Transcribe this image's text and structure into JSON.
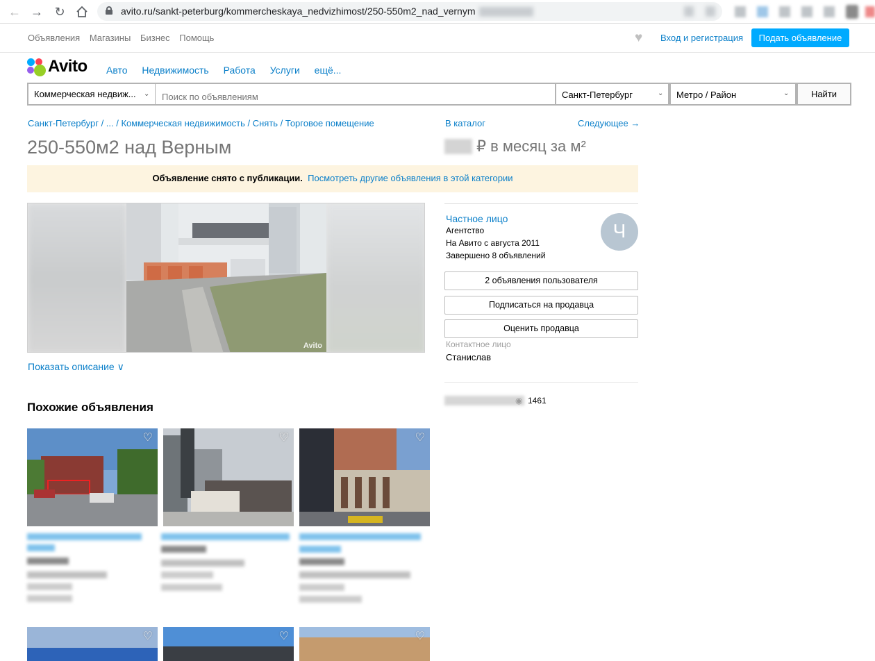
{
  "browser": {
    "url": "avito.ru/sankt-peterburg/kommercheskaya_nedvizhimost/250-550m2_nad_vernym"
  },
  "topnav": {
    "links": [
      "Объявления",
      "Магазины",
      "Бизнес",
      "Помощь"
    ],
    "login": "Вход и регистрация",
    "post_button": "Подать объявление"
  },
  "logo": {
    "text": "Avito"
  },
  "catnav": [
    "Авто",
    "Недвижимость",
    "Работа",
    "Услуги",
    "ещё..."
  ],
  "search": {
    "category": "Коммерческая недвиж...",
    "placeholder": "Поиск по объявлениям",
    "city": "Санкт-Петербург",
    "metro": "Метро / Район",
    "find_button": "Найти"
  },
  "breadcrumbs": "Санкт-Петербург / ... / Коммерческая недвижимость / Снять / Торговое помещение",
  "catalog_link": "В каталог",
  "next_link": "Следующее →",
  "listing": {
    "title": "250-550м2 над Верным",
    "price_suffix": "₽ в месяц за м²",
    "notice_bold": "Объявление снято с публикации.",
    "notice_link": "Посмотреть другие объявления в этой категории",
    "watermark": "Avito",
    "show_description": "Показать описание ∨"
  },
  "seller": {
    "name": "Частное лицо",
    "type": "Агентство",
    "since": "На Авито с августа 2011",
    "completed": "Завершено 8 объявлений",
    "avatar_letter": "Ч",
    "btn_ads": "2 объявления пользователя",
    "btn_subscribe": "Подписаться на продавца",
    "btn_rate": "Оценить продавца",
    "contact_label": "Контактное лицо",
    "contact_name": "Станислав",
    "views": "1461"
  },
  "similar": {
    "heading": "Похожие объявления"
  },
  "icons": {
    "favorite": "heart-icon",
    "views": "eye-icon"
  },
  "colors": {
    "link": "#0a7fc9",
    "accent_button": "#00aaff",
    "notice_bg": "#fdf4e0"
  }
}
